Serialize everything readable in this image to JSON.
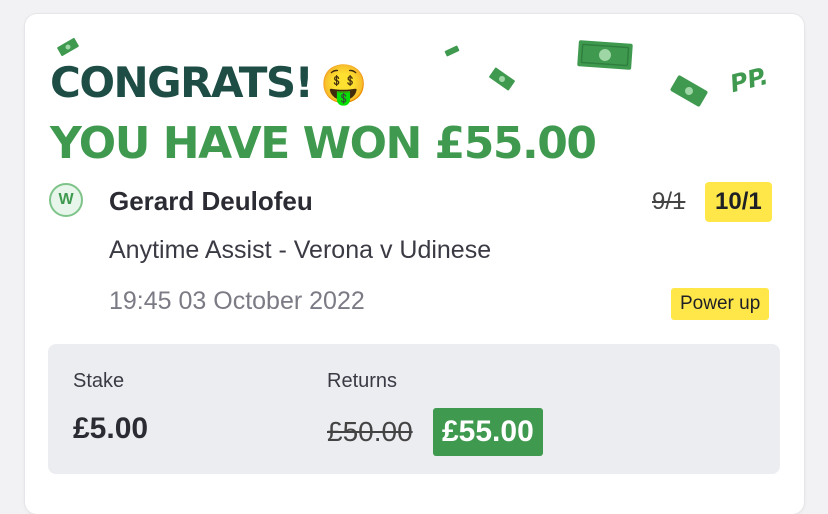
{
  "header": {
    "line1": "CONGRATS!",
    "emoji": "🤑",
    "line2": "YOU HAVE WON £55.00",
    "brand_logo": "PP."
  },
  "bet": {
    "status_badge": "W",
    "selection": "Gerard Deulofeu",
    "old_odds": "9/1",
    "new_odds": "10/1",
    "market": "Anytime Assist - Verona v Udinese",
    "datetime": "19:45 03 October 2022",
    "promo_tag": "Power up"
  },
  "summary": {
    "stake_label": "Stake",
    "stake_value": "£5.00",
    "returns_label": "Returns",
    "old_returns": "£50.00",
    "new_returns": "£55.00"
  },
  "colors": {
    "dark_green": "#1d4d45",
    "brand_green": "#3f9a4f",
    "highlight_yellow": "#ffe74a",
    "summary_bg": "#ecedf1"
  },
  "icons": [
    "money-bill-icon",
    "money-face-emoji",
    "win-badge-icon"
  ]
}
